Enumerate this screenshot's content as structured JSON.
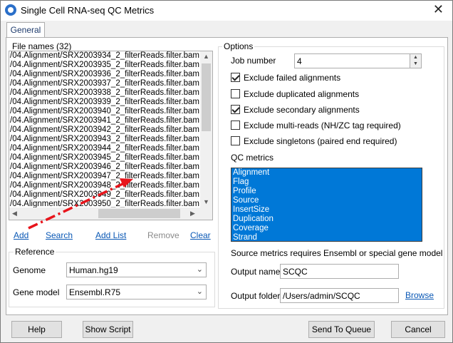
{
  "window": {
    "title": "Single Cell RNA-seq QC Metrics",
    "close_glyph": "✕"
  },
  "tabs": [
    {
      "label": "General"
    }
  ],
  "files": {
    "title": "File names (32)",
    "items": [
      "/04.Alignment/SRX2003934_2_filterReads.filter.bam",
      "/04.Alignment/SRX2003935_2_filterReads.filter.bam",
      "/04.Alignment/SRX2003936_2_filterReads.filter.bam",
      "/04.Alignment/SRX2003937_2_filterReads.filter.bam",
      "/04.Alignment/SRX2003938_2_filterReads.filter.bam",
      "/04.Alignment/SRX2003939_2_filterReads.filter.bam",
      "/04.Alignment/SRX2003940_2_filterReads.filter.bam",
      "/04.Alignment/SRX2003941_2_filterReads.filter.bam",
      "/04.Alignment/SRX2003942_2_filterReads.filter.bam",
      "/04.Alignment/SRX2003943_2_filterReads.filter.bam",
      "/04.Alignment/SRX2003944_2_filterReads.filter.bam",
      "/04.Alignment/SRX2003945_2_filterReads.filter.bam",
      "/04.Alignment/SRX2003946_2_filterReads.filter.bam",
      "/04.Alignment/SRX2003947_2_filterReads.filter.bam",
      "/04.Alignment/SRX2003948_2_filterReads.filter.bam",
      "/04.Alignment/SRX2003949_2_filterReads.filter.bam",
      "/04.Alignment/SRX2003950_2_filterReads.filter.bam"
    ],
    "actions": {
      "add": "Add",
      "search": "Search",
      "add_list": "Add List",
      "remove": "Remove",
      "clear": "Clear"
    }
  },
  "reference": {
    "title": "Reference",
    "genome_label": "Genome",
    "genome_value": "Human.hg19",
    "gene_model_label": "Gene model",
    "gene_model_value": "Ensembl.R75"
  },
  "options": {
    "title": "Options",
    "job_number_label": "Job number",
    "job_number_value": "4",
    "checkboxes": [
      {
        "label": "Exclude failed alignments",
        "checked": true
      },
      {
        "label": "Exclude duplicated alignments",
        "checked": false
      },
      {
        "label": "Exclude secondary alignments",
        "checked": true
      },
      {
        "label": "Exclude multi-reads (NH/ZC tag required)",
        "checked": false
      },
      {
        "label": "Exclude singletons (paired end required)",
        "checked": false
      }
    ],
    "qc_metrics_label": "QC metrics",
    "qc_metrics": [
      "Alignment",
      "Flag",
      "Profile",
      "Source",
      "InsertSize",
      "Duplication",
      "Coverage",
      "Strand"
    ],
    "source_note": "Source metrics requires Ensembl or special gene model",
    "output_name_label": "Output name",
    "output_name_value": "SCQC",
    "output_folder_label": "Output folder",
    "output_folder_value": "/Users/admin/SCQC",
    "browse_label": "Browse"
  },
  "footer": {
    "help": "Help",
    "show_script": "Show Script",
    "send_to_queue": "Send To Queue",
    "cancel": "Cancel"
  },
  "colors": {
    "selection": "#0078d7",
    "link": "#0a58b5",
    "annotation_arrow": "#e8141b"
  }
}
